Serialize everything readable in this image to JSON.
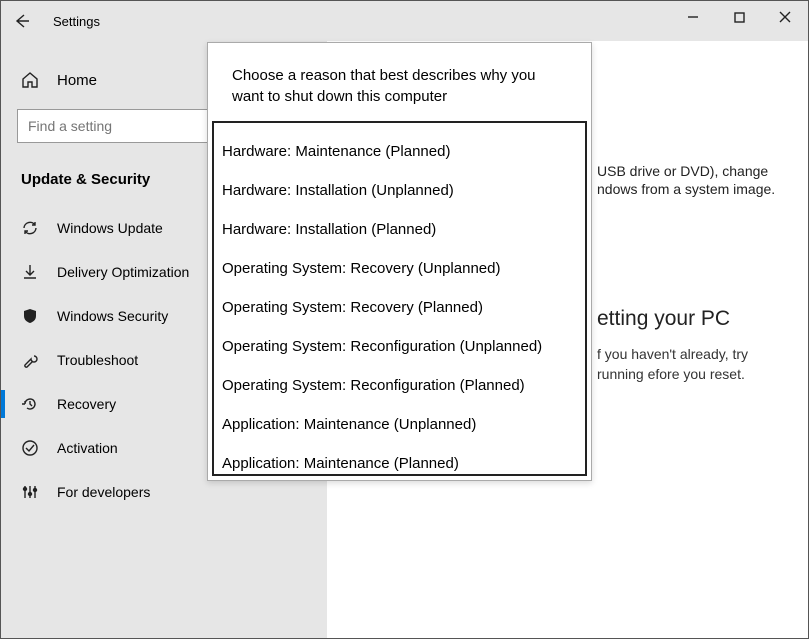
{
  "titlebar": {
    "app_title": "Settings"
  },
  "sidebar": {
    "home_label": "Home",
    "search_placeholder": "Find a setting",
    "section_title": "Update & Security",
    "items": [
      {
        "label": "Windows Update"
      },
      {
        "label": "Delivery Optimization"
      },
      {
        "label": "Windows Security"
      },
      {
        "label": "Troubleshoot"
      },
      {
        "label": "Recovery"
      },
      {
        "label": "Activation"
      },
      {
        "label": "For developers"
      }
    ]
  },
  "content": {
    "line1": "USB drive or DVD), change",
    "line2": "ndows from a system image.",
    "heading": "etting your PC",
    "body": "f you haven't already, try running efore you reset."
  },
  "popup": {
    "prompt": "Choose a reason that best describes why you want to shut down this computer",
    "options": [
      "Hardware: Maintenance (Planned)",
      "Hardware: Installation (Unplanned)",
      "Hardware: Installation (Planned)",
      "Operating System: Recovery (Unplanned)",
      "Operating System: Recovery (Planned)",
      "Operating System: Reconfiguration (Unplanned)",
      "Operating System: Reconfiguration (Planned)",
      "Application: Maintenance (Unplanned)",
      "Application: Maintenance (Planned)"
    ]
  }
}
